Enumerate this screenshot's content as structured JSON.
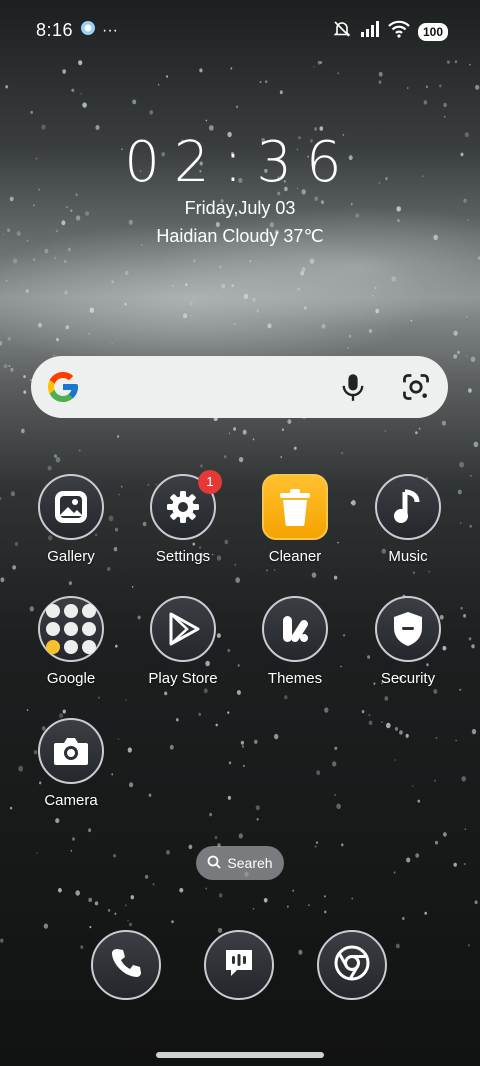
{
  "status_bar": {
    "time": "8:16",
    "more": "···",
    "battery": "100",
    "icons": [
      "app-notification-icon",
      "silent-icon",
      "signal-icon",
      "wifi-icon",
      "battery-icon"
    ]
  },
  "clock": {
    "time": "02:36",
    "date": "Friday,July 03",
    "weather": "Haidian Cloudy 37℃"
  },
  "search_bar": {
    "icons": [
      "google-logo-icon",
      "microphone-icon",
      "google-lens-icon"
    ]
  },
  "apps": [
    {
      "label": "Gallery",
      "icon": "gallery-icon"
    },
    {
      "label": "Settings",
      "icon": "gear-icon",
      "badge": "1"
    },
    {
      "label": "Cleaner",
      "icon": "trash-icon"
    },
    {
      "label": "Music",
      "icon": "music-note-icon"
    },
    {
      "label": "Google",
      "icon": "folder-icon"
    },
    {
      "label": "Play Store",
      "icon": "play-store-icon"
    },
    {
      "label": "Themes",
      "icon": "themes-icon"
    },
    {
      "label": "Security",
      "icon": "shield-icon"
    },
    {
      "label": "Camera",
      "icon": "camera-icon"
    }
  ],
  "app_search": {
    "label": "Seareh"
  },
  "dock": [
    {
      "icon": "phone-icon"
    },
    {
      "icon": "messages-icon"
    },
    {
      "icon": "chrome-icon"
    }
  ]
}
